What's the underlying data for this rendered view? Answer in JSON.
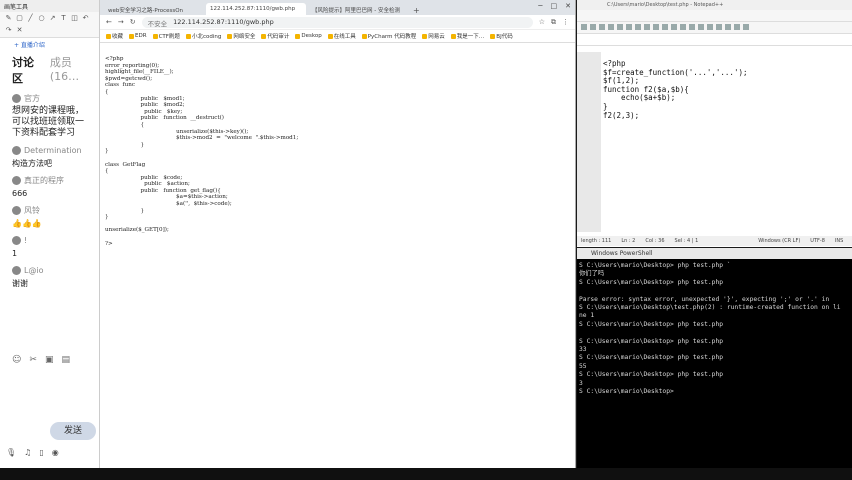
{
  "chat": {
    "title": "画笔工具",
    "add_label": "+ 直播介绍",
    "tabs": [
      "讨论区",
      "成员(16…"
    ],
    "messages": [
      {
        "name": "官方",
        "text": "欢迎 ​ 官方报名-…"
      },
      {
        "name": "",
        "text": "想网安的课程哦，可以找班班领取一下资料配套学习"
      },
      {
        "name": "Determination",
        "text": "构造方法吧"
      },
      {
        "name": "真正的程序",
        "text": "666"
      },
      {
        "name": "风铃",
        "text": "👍👍👍"
      },
      {
        "name": "!",
        "text": "1"
      },
      {
        "name": "L@io",
        "text": "谢谢"
      }
    ],
    "send_label": "发送"
  },
  "browser": {
    "tabs": [
      "web安全学习之路-ProcessOn",
      "122.114.252.87:1110/gwb.php",
      "【风险提示】阿里巴巴网 - 安全检测"
    ],
    "url_warning": "不安全",
    "url": "122.114.252.87:1110/gwb.php",
    "bookmarks": [
      "收藏",
      "EDR",
      "CTF刷题",
      "小北coding",
      "网络安全",
      "代码审计",
      "Deskop",
      "在线工具",
      "PyCharm 代码教程",
      "网易云",
      "我是一下…",
      "BJ代码"
    ],
    "source": "<?php\nerror_reporting(0);\nhighlight_file(__FILE__);\n$pwd=getcwd();\nclass  func\n{\n                    public   $mod1;\n                    public   $mod2;\n                      public   $key;\n                    public   function  __destruct()\n                    {\n                                        unserialize($this->key)();\n                                        $this->mod2  =  \"welcome  \".$this->mod1;\n                    }\n}\n\nclass  GetFlag\n{\n                    public   $code;\n                      public   $action;\n                    public   function  get_flag(){\n                                        $a=$this->action;\n                                        $a('',  $this->code);\n                    }\n}\n\nunserialize($_GET[0]);\n\n?>"
  },
  "npp": {
    "title": "C:\\Users\\mario\\Desktop\\test.php - Notepad++",
    "code": "<?php\n$f=create_function('...','...');\n$f(1,2);\nfunction f2($a,$b){\n    echo($a+$b);\n}\nf2(2,3);",
    "status": [
      "length : 111",
      "Ln : 2",
      "Col : 36",
      "Sel : 4 | 1",
      "Windows (CR LF)",
      "UTF-8",
      "INS"
    ]
  },
  "powershell": {
    "title": "Windows PowerShell",
    "output": "S C:\\Users\\mario\\Desktop> php test.php `\n你们了吗\nS C:\\Users\\mario\\Desktop> php test.php\n\nParse error: syntax error, unexpected '}', expecting ';' or '.' in\nS C:\\Users\\mario\\Desktop\\test.php(2) : runtime-created function on li\nne 1\nS C:\\Users\\mario\\Desktop> php test.php\n\nS C:\\Users\\mario\\Desktop> php test.php\n33\nS C:\\Users\\mario\\Desktop> php test.php\n55\nS C:\\Users\\mario\\Desktop> php test.php\n3\nS C:\\Users\\mario\\Desktop>"
  }
}
